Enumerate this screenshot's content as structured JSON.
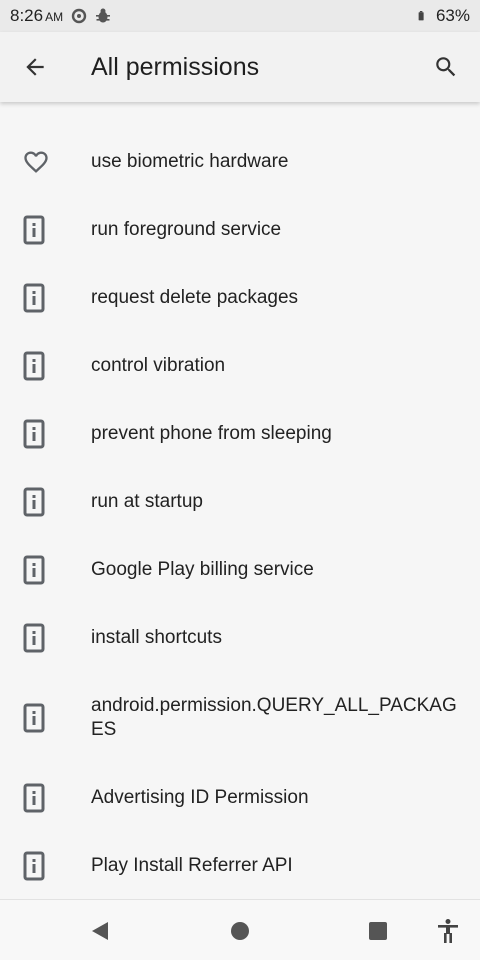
{
  "status_bar": {
    "time": "8:26",
    "ampm": "AM",
    "battery_percent": "63%",
    "icons": [
      "sync-icon",
      "bug-icon",
      "battery-icon"
    ]
  },
  "app_bar": {
    "title": "All permissions",
    "back_icon": "arrow-back-icon",
    "search_icon": "search-icon"
  },
  "permissions": [
    {
      "label": "use biometric hardware",
      "icon": "heart-outline-icon"
    },
    {
      "label": "run foreground service",
      "icon": "phone-info-icon"
    },
    {
      "label": "request delete packages",
      "icon": "phone-info-icon"
    },
    {
      "label": "control vibration",
      "icon": "phone-info-icon"
    },
    {
      "label": "prevent phone from sleeping",
      "icon": "phone-info-icon"
    },
    {
      "label": "run at startup",
      "icon": "phone-info-icon"
    },
    {
      "label": "Google Play billing service",
      "icon": "phone-info-icon"
    },
    {
      "label": "install shortcuts",
      "icon": "phone-info-icon"
    },
    {
      "label": "android.permission.QUERY_ALL_PACKAGES",
      "icon": "phone-info-icon"
    },
    {
      "label": "Advertising ID Permission",
      "icon": "phone-info-icon"
    },
    {
      "label": "Play Install Referrer API",
      "icon": "phone-info-icon"
    }
  ],
  "nav_bar": {
    "icons": [
      "back-triangle-icon",
      "home-circle-icon",
      "recents-square-icon",
      "accessibility-icon"
    ]
  }
}
